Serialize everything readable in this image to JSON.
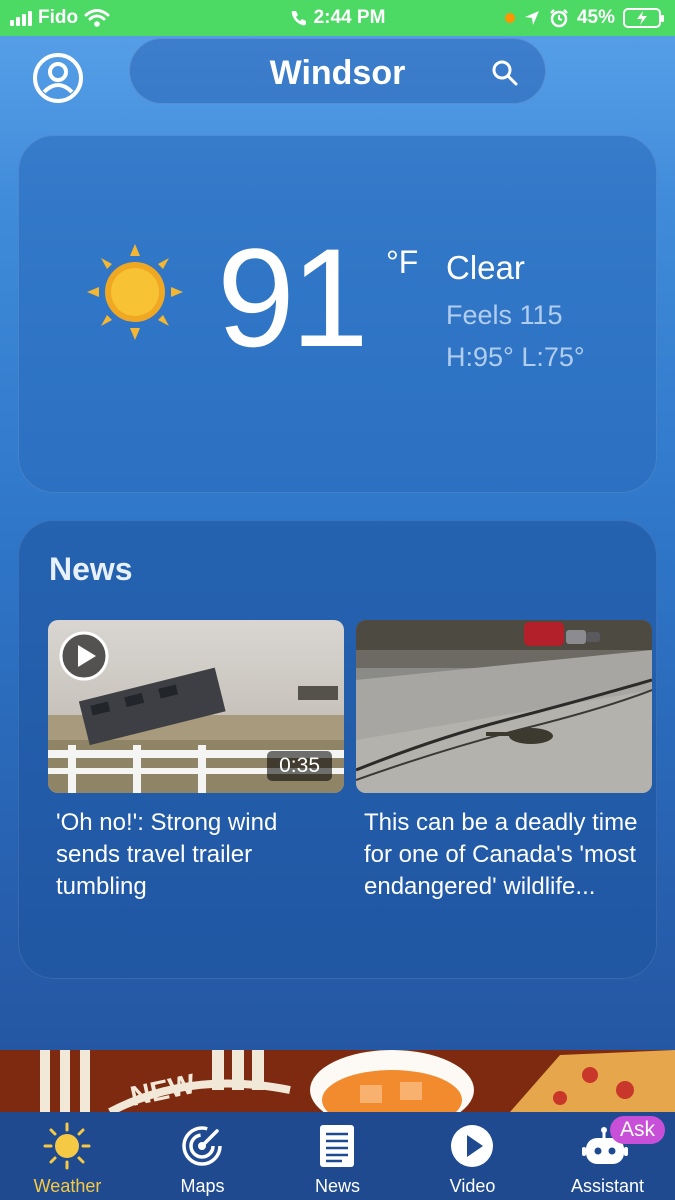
{
  "status_bar": {
    "carrier": "Fido",
    "time": "2:44 PM",
    "battery": "45%",
    "bar_color": "#4cd964"
  },
  "header": {
    "city": "Windsor",
    "avatar_icon": "user-icon",
    "search_icon": "search-icon"
  },
  "current": {
    "temperature": "91",
    "unit": "°F",
    "condition": "Clear",
    "feels_like": "Feels 115",
    "high_low": "H:95° L:75°",
    "icon": "sun-icon"
  },
  "news": {
    "heading": "News",
    "items": [
      {
        "headline": "'Oh no!': Strong wind sends travel trailer tumbling",
        "duration": "0:35",
        "has_video": true
      },
      {
        "headline": "This can be a deadly time for one of Canada's 'most endangered' wildlife...",
        "has_video": false
      }
    ]
  },
  "ad": {
    "text": "NEW"
  },
  "tabs": [
    {
      "label": "Weather",
      "icon": "sun-icon",
      "active": true
    },
    {
      "label": "Maps",
      "icon": "radar-icon",
      "active": false
    },
    {
      "label": "News",
      "icon": "newspaper-icon",
      "active": false
    },
    {
      "label": "Video",
      "icon": "play-icon",
      "active": false
    },
    {
      "label": "Assistant",
      "icon": "robot-icon",
      "active": false,
      "badge": "Ask"
    }
  ],
  "colors": {
    "active_tab": "#f6c945",
    "tab_bar": "#1f4a8f",
    "ask_badge": "#c84fd8"
  }
}
